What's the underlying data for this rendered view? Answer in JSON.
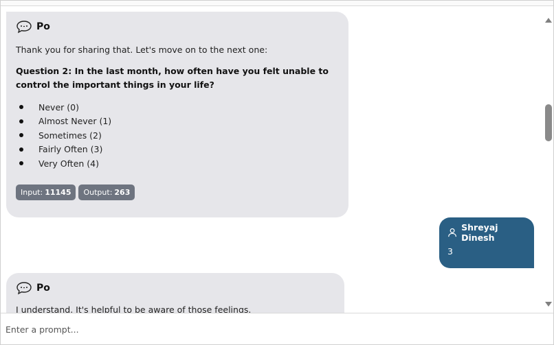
{
  "messages": [
    {
      "sender": "Po",
      "intro": "Thank you for sharing that. Let's move on to the next one:",
      "question": "Question 2: In the last month, how often have you felt unable to control the important things in your life?",
      "options": [
        "Never (0)",
        "Almost Never (1)",
        "Sometimes (2)",
        "Fairly Often (3)",
        "Very Often (4)"
      ],
      "tokens": {
        "input_label": "Input:",
        "input_value": "11145",
        "output_label": "Output:",
        "output_value": "263"
      }
    },
    {
      "sender": "Shreyaj Dinesh",
      "text": "3"
    },
    {
      "sender": "Po",
      "text": "I understand. It's helpful to be aware of those feelings."
    }
  ],
  "input": {
    "placeholder": "Enter a prompt..."
  },
  "colors": {
    "bot_bubble": "#e6e6ea",
    "user_bubble": "#2a5f84",
    "token_badge": "#6e7480"
  },
  "icons": {
    "bot": "chat-bubble-icon",
    "user": "user-icon"
  }
}
